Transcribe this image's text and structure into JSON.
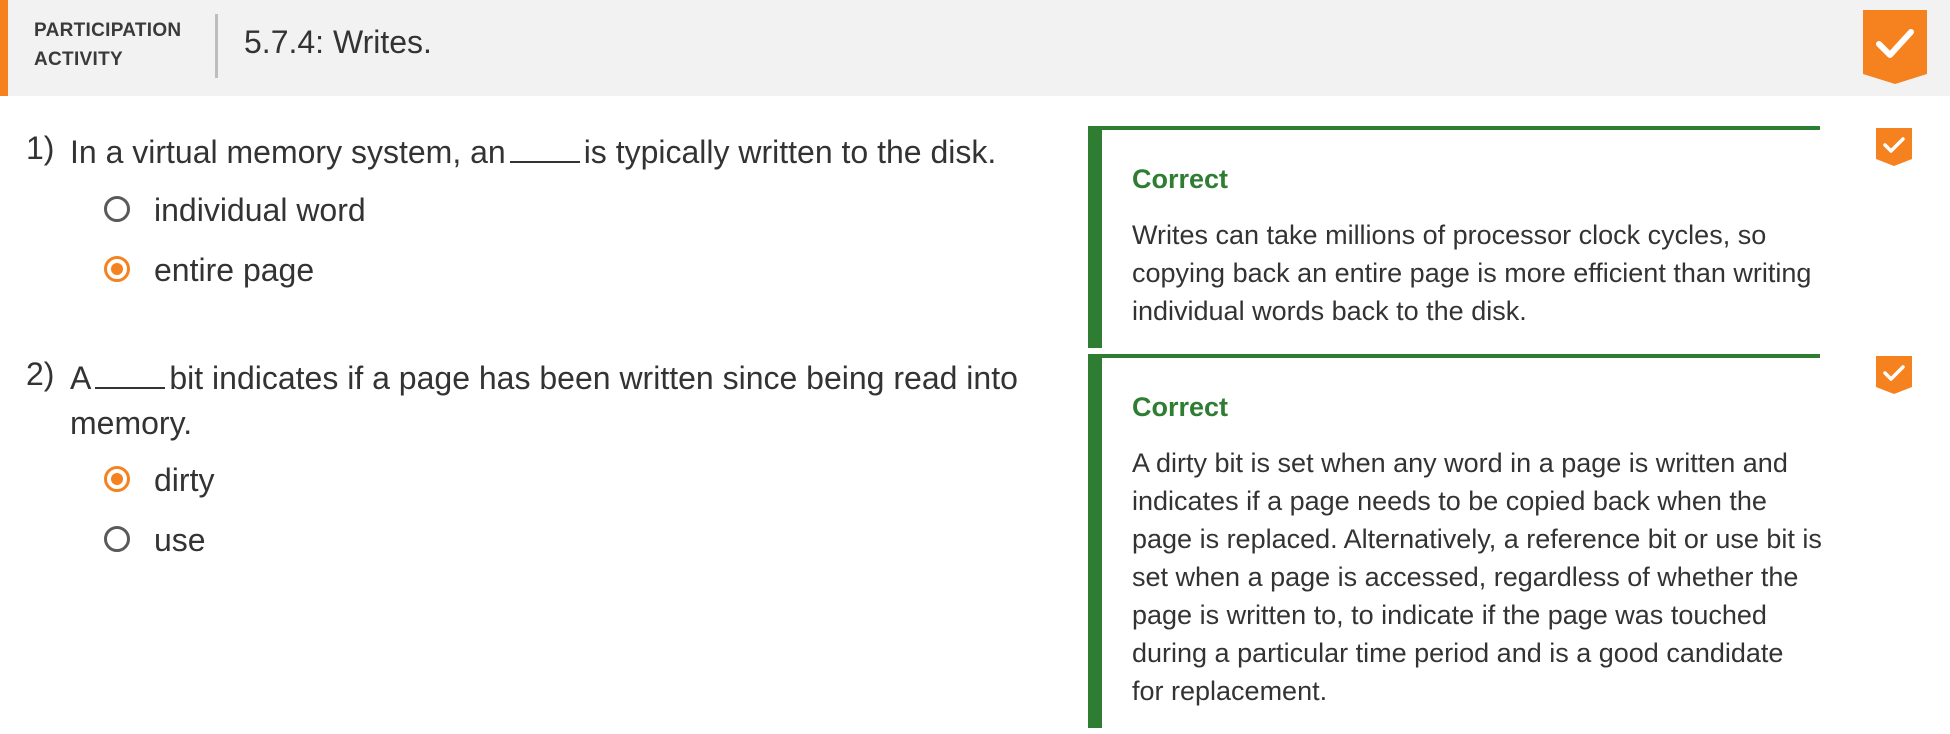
{
  "header": {
    "label_line1": "PARTICIPATION",
    "label_line2": "ACTIVITY",
    "title": "5.7.4: Writes."
  },
  "colors": {
    "accent": "#f5821f",
    "correct": "#2e7d32",
    "header_bg": "#f2f2f2"
  },
  "questions": [
    {
      "number": "1)",
      "text_before": "In a virtual memory system, an",
      "text_after": "is typically written to the disk.",
      "options": [
        {
          "label": "individual word",
          "selected": false
        },
        {
          "label": "entire page",
          "selected": true
        }
      ],
      "feedback": {
        "title": "Correct",
        "text": "Writes can take millions of processor clock cycles, so copying back an entire page is more efficient than writing individual words back to the disk."
      },
      "status_icon": "check-icon"
    },
    {
      "number": "2)",
      "text_before": "A",
      "text_after": "bit indicates if a page has been written since being read into memory.",
      "options": [
        {
          "label": "dirty",
          "selected": true
        },
        {
          "label": "use",
          "selected": false
        }
      ],
      "feedback": {
        "title": "Correct",
        "text": "A dirty bit is set when any word in a page is written and indicates if a page needs to be copied back when the page is replaced. Alternatively, a reference bit or use bit is set when a page is accessed, regardless of whether the page is written to, to indicate if the page was touched during a particular time period and is a good candidate for replacement."
      },
      "status_icon": "check-icon"
    }
  ]
}
